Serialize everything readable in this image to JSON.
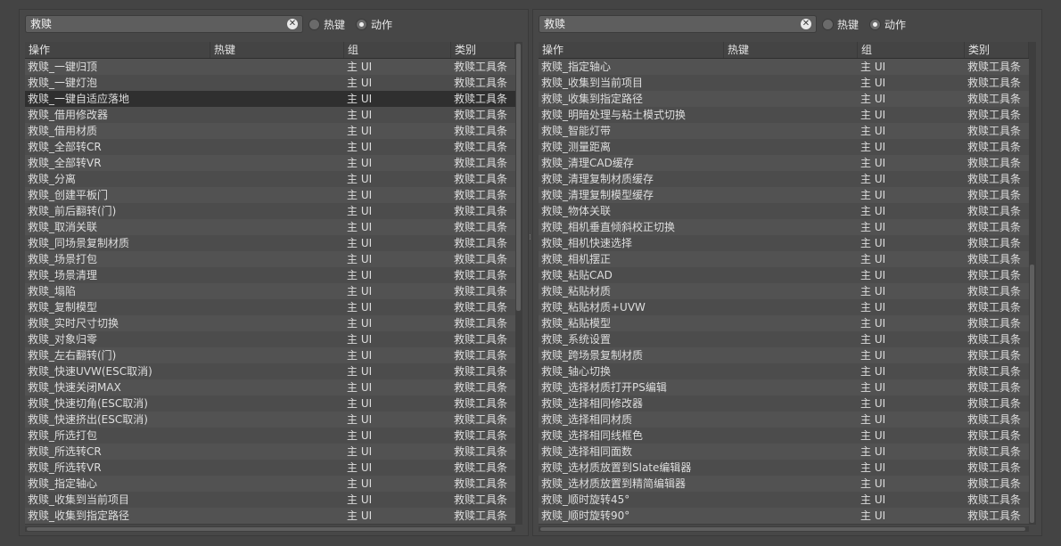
{
  "left_panel": {
    "search_value": "救赎",
    "radio_hotkey": "热键",
    "radio_action": "动作",
    "selected_radio": "action",
    "columns": [
      "操作",
      "热键",
      "组",
      "类别"
    ],
    "selected_row": 2,
    "rows": [
      [
        "救赎_一键归顶",
        "",
        "主 UI",
        "救赎工具条"
      ],
      [
        "救赎_一键灯泡",
        "",
        "主 UI",
        "救赎工具条"
      ],
      [
        "救赎_一键自适应落地",
        "",
        "主 UI",
        "救赎工具条"
      ],
      [
        "救赎_借用修改器",
        "",
        "主 UI",
        "救赎工具条"
      ],
      [
        "救赎_借用材质",
        "",
        "主 UI",
        "救赎工具条"
      ],
      [
        "救赎_全部转CR",
        "",
        "主 UI",
        "救赎工具条"
      ],
      [
        "救赎_全部转VR",
        "",
        "主 UI",
        "救赎工具条"
      ],
      [
        "救赎_分离",
        "",
        "主 UI",
        "救赎工具条"
      ],
      [
        "救赎_创建平板门",
        "",
        "主 UI",
        "救赎工具条"
      ],
      [
        "救赎_前后翻转(门)",
        "",
        "主 UI",
        "救赎工具条"
      ],
      [
        "救赎_取消关联",
        "",
        "主 UI",
        "救赎工具条"
      ],
      [
        "救赎_同场景复制材质",
        "",
        "主 UI",
        "救赎工具条"
      ],
      [
        "救赎_场景打包",
        "",
        "主 UI",
        "救赎工具条"
      ],
      [
        "救赎_场景清理",
        "",
        "主 UI",
        "救赎工具条"
      ],
      [
        "救赎_塌陷",
        "",
        "主 UI",
        "救赎工具条"
      ],
      [
        "救赎_复制模型",
        "",
        "主 UI",
        "救赎工具条"
      ],
      [
        "救赎_实时尺寸切换",
        "",
        "主 UI",
        "救赎工具条"
      ],
      [
        "救赎_对象归零",
        "",
        "主 UI",
        "救赎工具条"
      ],
      [
        "救赎_左右翻转(门)",
        "",
        "主 UI",
        "救赎工具条"
      ],
      [
        "救赎_快速UVW(ESC取消)",
        "",
        "主 UI",
        "救赎工具条"
      ],
      [
        "救赎_快速关闭MAX",
        "",
        "主 UI",
        "救赎工具条"
      ],
      [
        "救赎_快速切角(ESC取消)",
        "",
        "主 UI",
        "救赎工具条"
      ],
      [
        "救赎_快速挤出(ESC取消)",
        "",
        "主 UI",
        "救赎工具条"
      ],
      [
        "救赎_所选打包",
        "",
        "主 UI",
        "救赎工具条"
      ],
      [
        "救赎_所选转CR",
        "",
        "主 UI",
        "救赎工具条"
      ],
      [
        "救赎_所选转VR",
        "",
        "主 UI",
        "救赎工具条"
      ],
      [
        "救赎_指定轴心",
        "",
        "主 UI",
        "救赎工具条"
      ],
      [
        "救赎_收集到当前项目",
        "",
        "主 UI",
        "救赎工具条"
      ],
      [
        "救赎_收集到指定路径",
        "",
        "主 UI",
        "救赎工具条"
      ]
    ]
  },
  "right_panel": {
    "search_value": "救赎",
    "radio_hotkey": "热键",
    "radio_action": "动作",
    "selected_radio": "action",
    "columns": [
      "操作",
      "热键",
      "组",
      "类别"
    ],
    "selected_row": -1,
    "rows": [
      [
        "救赎_指定轴心",
        "",
        "主 UI",
        "救赎工具条"
      ],
      [
        "救赎_收集到当前项目",
        "",
        "主 UI",
        "救赎工具条"
      ],
      [
        "救赎_收集到指定路径",
        "",
        "主 UI",
        "救赎工具条"
      ],
      [
        "救赎_明暗处理与粘土模式切换",
        "",
        "主 UI",
        "救赎工具条"
      ],
      [
        "救赎_智能灯带",
        "",
        "主 UI",
        "救赎工具条"
      ],
      [
        "救赎_测量距离",
        "",
        "主 UI",
        "救赎工具条"
      ],
      [
        "救赎_清理CAD缓存",
        "",
        "主 UI",
        "救赎工具条"
      ],
      [
        "救赎_清理复制材质缓存",
        "",
        "主 UI",
        "救赎工具条"
      ],
      [
        "救赎_清理复制模型缓存",
        "",
        "主 UI",
        "救赎工具条"
      ],
      [
        "救赎_物体关联",
        "",
        "主 UI",
        "救赎工具条"
      ],
      [
        "救赎_相机垂直倾斜校正切换",
        "",
        "主 UI",
        "救赎工具条"
      ],
      [
        "救赎_相机快速选择",
        "",
        "主 UI",
        "救赎工具条"
      ],
      [
        "救赎_相机摆正",
        "",
        "主 UI",
        "救赎工具条"
      ],
      [
        "救赎_粘贴CAD",
        "",
        "主 UI",
        "救赎工具条"
      ],
      [
        "救赎_粘贴材质",
        "",
        "主 UI",
        "救赎工具条"
      ],
      [
        "救赎_粘贴材质+UVW",
        "",
        "主 UI",
        "救赎工具条"
      ],
      [
        "救赎_粘贴模型",
        "",
        "主 UI",
        "救赎工具条"
      ],
      [
        "救赎_系统设置",
        "",
        "主 UI",
        "救赎工具条"
      ],
      [
        "救赎_跨场景复制材质",
        "",
        "主 UI",
        "救赎工具条"
      ],
      [
        "救赎_轴心切换",
        "",
        "主 UI",
        "救赎工具条"
      ],
      [
        "救赎_选择材质打开PS编辑",
        "",
        "主 UI",
        "救赎工具条"
      ],
      [
        "救赎_选择相同修改器",
        "",
        "主 UI",
        "救赎工具条"
      ],
      [
        "救赎_选择相同材质",
        "",
        "主 UI",
        "救赎工具条"
      ],
      [
        "救赎_选择相同线框色",
        "",
        "主 UI",
        "救赎工具条"
      ],
      [
        "救赎_选择相同面数",
        "",
        "主 UI",
        "救赎工具条"
      ],
      [
        "救赎_选材质放置到Slate编辑器",
        "",
        "主 UI",
        "救赎工具条"
      ],
      [
        "救赎_选材质放置到精简编辑器",
        "",
        "主 UI",
        "救赎工具条"
      ],
      [
        "救赎_顺时旋转45°",
        "",
        "主 UI",
        "救赎工具条"
      ],
      [
        "救赎_顺时旋转90°",
        "",
        "主 UI",
        "救赎工具条"
      ]
    ]
  },
  "icons": {
    "clear": "clear-icon",
    "radio": "radio-button"
  }
}
